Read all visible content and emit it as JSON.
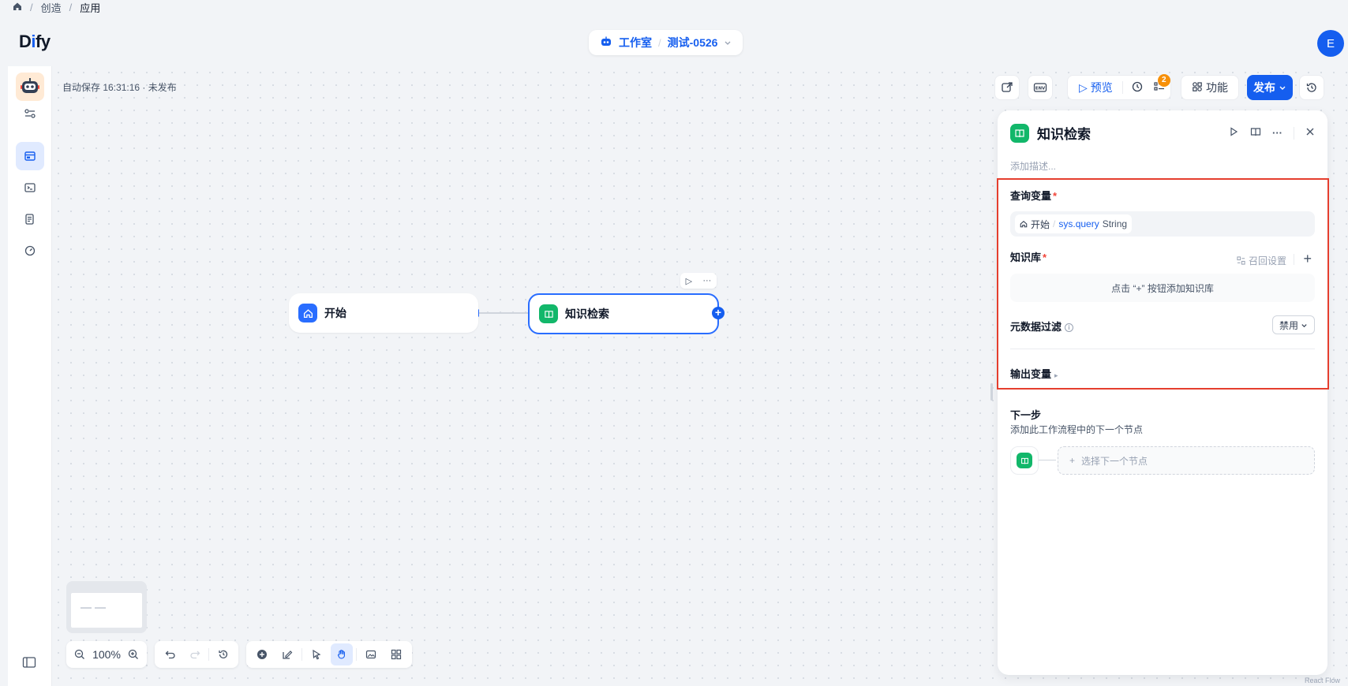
{
  "breadcrumb": {
    "items": [
      "创造",
      "应用"
    ]
  },
  "header": {
    "logo_left": "D",
    "logo_accent": "i",
    "logo_right": "fy",
    "studio_label": "工作室",
    "app_name": "测试-0526",
    "avatar_letter": "E"
  },
  "canvas": {
    "autosave": "自动保存 16:31:16 · 未发布",
    "nodes": {
      "start_label": "开始",
      "knowledge_label": "知识检索"
    }
  },
  "toolbar": {
    "preview_label": "预览",
    "checklist_badge": "2",
    "features_label": "功能",
    "publish_label": "发布",
    "zoom": "100%"
  },
  "panel": {
    "title": "知识检索",
    "description_placeholder": "添加描述...",
    "query_label": "查询变量",
    "query_chip": {
      "node": "开始",
      "var": "sys.query",
      "type": "String"
    },
    "kb_label": "知识库",
    "recall_label": "召回设置",
    "kb_empty": "点击 “+” 按钮添加知识库",
    "meta_label": "元数据过滤",
    "meta_value": "禁用",
    "output_label": "输出变量",
    "next_title": "下一步",
    "next_sub": "添加此工作流程中的下一个节点",
    "select_next": "选择下一个节点"
  },
  "footer": {
    "reactflow": "React Flow"
  },
  "colors": {
    "accent": "#155eef",
    "knowledge_node": "#12b76a",
    "highlight": "#e53e2e",
    "badge": "#f79009"
  }
}
